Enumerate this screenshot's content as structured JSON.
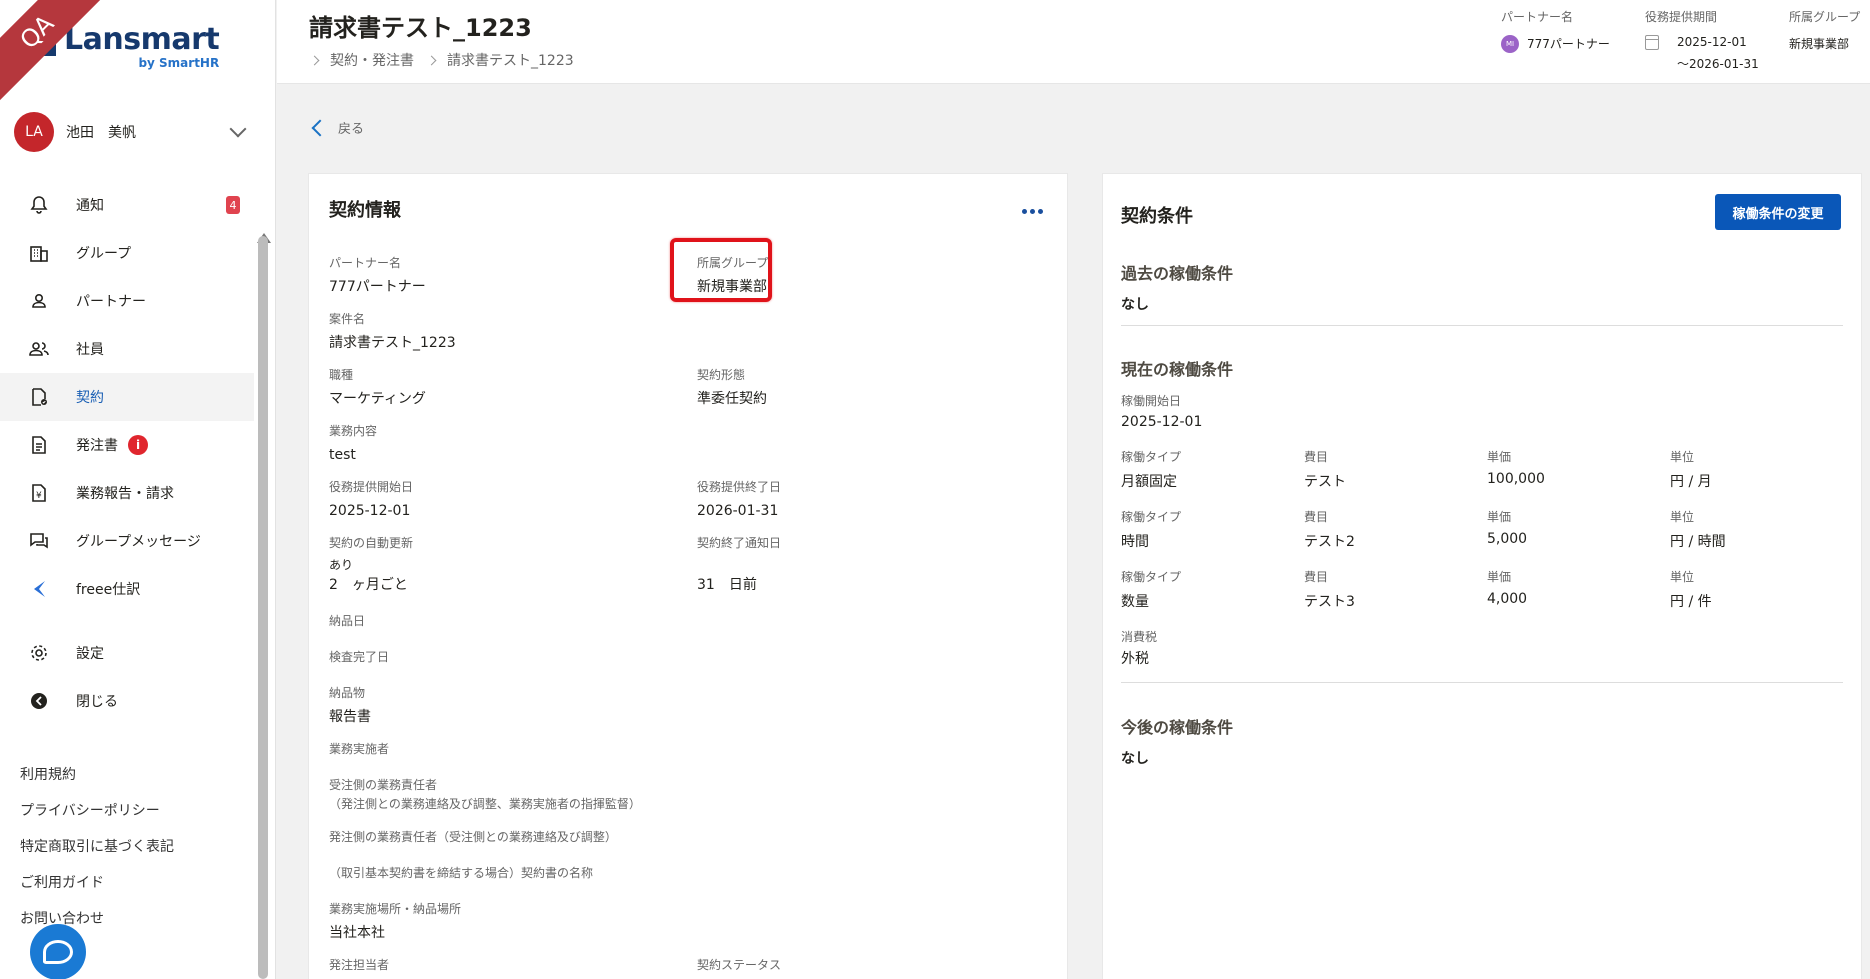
{
  "ribbon": "QA",
  "brand": {
    "name": "Lansmart",
    "sub": "by SmartHR"
  },
  "user": {
    "initials": "LA",
    "name": "池田　美帆"
  },
  "nav": {
    "notifications": {
      "label": "通知",
      "badge": "4"
    },
    "groups": "グループ",
    "partners": "パートナー",
    "employees": "社員",
    "contracts": "契約",
    "orders": {
      "label": "発注書",
      "alert": "i"
    },
    "reports": "業務報告・請求",
    "group_messages": "グループメッセージ",
    "freee": "freee仕訳",
    "settings": "設定",
    "close": "閉じる"
  },
  "footer_links": [
    "利用規約",
    "プライバシーポリシー",
    "特定商取引に基づく表記",
    "ご利用ガイド",
    "お問い合わせ"
  ],
  "header": {
    "title": "請求書テスト_1223",
    "breadcrumb": [
      "契約・発注書",
      "請求書テスト_1223"
    ],
    "partner": {
      "label": "パートナー名",
      "initials": "MI",
      "value": "777パートナー"
    },
    "period": {
      "label": "役務提供期間",
      "start": "2025-12-01",
      "end": "〜2026-01-31"
    },
    "group": {
      "label": "所属グループ",
      "value": "新規事業部"
    }
  },
  "back_label": "戻る",
  "contract_info": {
    "title": "契約情報",
    "partner_name": {
      "label": "パートナー名",
      "value": "777パートナー"
    },
    "group": {
      "label": "所属グループ",
      "value": "新規事業部"
    },
    "project_name": {
      "label": "案件名",
      "value": "請求書テスト_1223"
    },
    "job_type": {
      "label": "職種",
      "value": "マーケティング"
    },
    "contract_form": {
      "label": "契約形態",
      "value": "準委任契約"
    },
    "work_content": {
      "label": "業務内容",
      "value": "test"
    },
    "start_date": {
      "label": "役務提供開始日",
      "value": "2025-12-01"
    },
    "end_date": {
      "label": "役務提供終了日",
      "value": "2026-01-31"
    },
    "auto_renew": {
      "label": "契約の自動更新",
      "value": "あり",
      "value2": "2　ヶ月ごと"
    },
    "end_notice": {
      "label": "契約終了通知日",
      "value": "31　日前"
    },
    "delivery_date": {
      "label": "納品日"
    },
    "inspection_date": {
      "label": "検査完了日"
    },
    "deliverable": {
      "label": "納品物",
      "value": "報告書"
    },
    "performer": {
      "label": "業務実施者"
    },
    "receiver_manager": {
      "label": "受注側の業務責任者",
      "label2": "（発注側との業務連絡及び調整、業務実施者の指揮監督）"
    },
    "orderer_manager": {
      "label": "発注側の業務責任者（受注側との業務連絡及び調整）"
    },
    "base_contract": {
      "label": "（取引基本契約書を締結する場合）契約書の名称"
    },
    "work_place": {
      "label": "業務実施場所・納品場所",
      "value": "当社本社"
    },
    "order_owner": {
      "label": "発注担当者"
    },
    "status": {
      "label": "契約ステータス"
    }
  },
  "contract_terms": {
    "title": "契約条件",
    "change_button": "稼働条件の変更",
    "past": {
      "title": "過去の稼働条件",
      "value": "なし"
    },
    "current": {
      "title": "現在の稼働条件",
      "start": {
        "label": "稼働開始日",
        "value": "2025-12-01"
      },
      "col_labels": {
        "type": "稼働タイプ",
        "item": "費目",
        "price": "単価",
        "unit": "単位"
      },
      "rows": [
        {
          "type": "月額固定",
          "item": "テスト",
          "price": "100,000",
          "unit": "円 / 月"
        },
        {
          "type": "時間",
          "item": "テスト2",
          "price": "5,000",
          "unit": "円 / 時間"
        },
        {
          "type": "数量",
          "item": "テスト3",
          "price": "4,000",
          "unit": "円 / 件"
        }
      ],
      "tax": {
        "label": "消費税",
        "value": "外税"
      }
    },
    "future": {
      "title": "今後の稼働条件",
      "value": "なし"
    }
  }
}
